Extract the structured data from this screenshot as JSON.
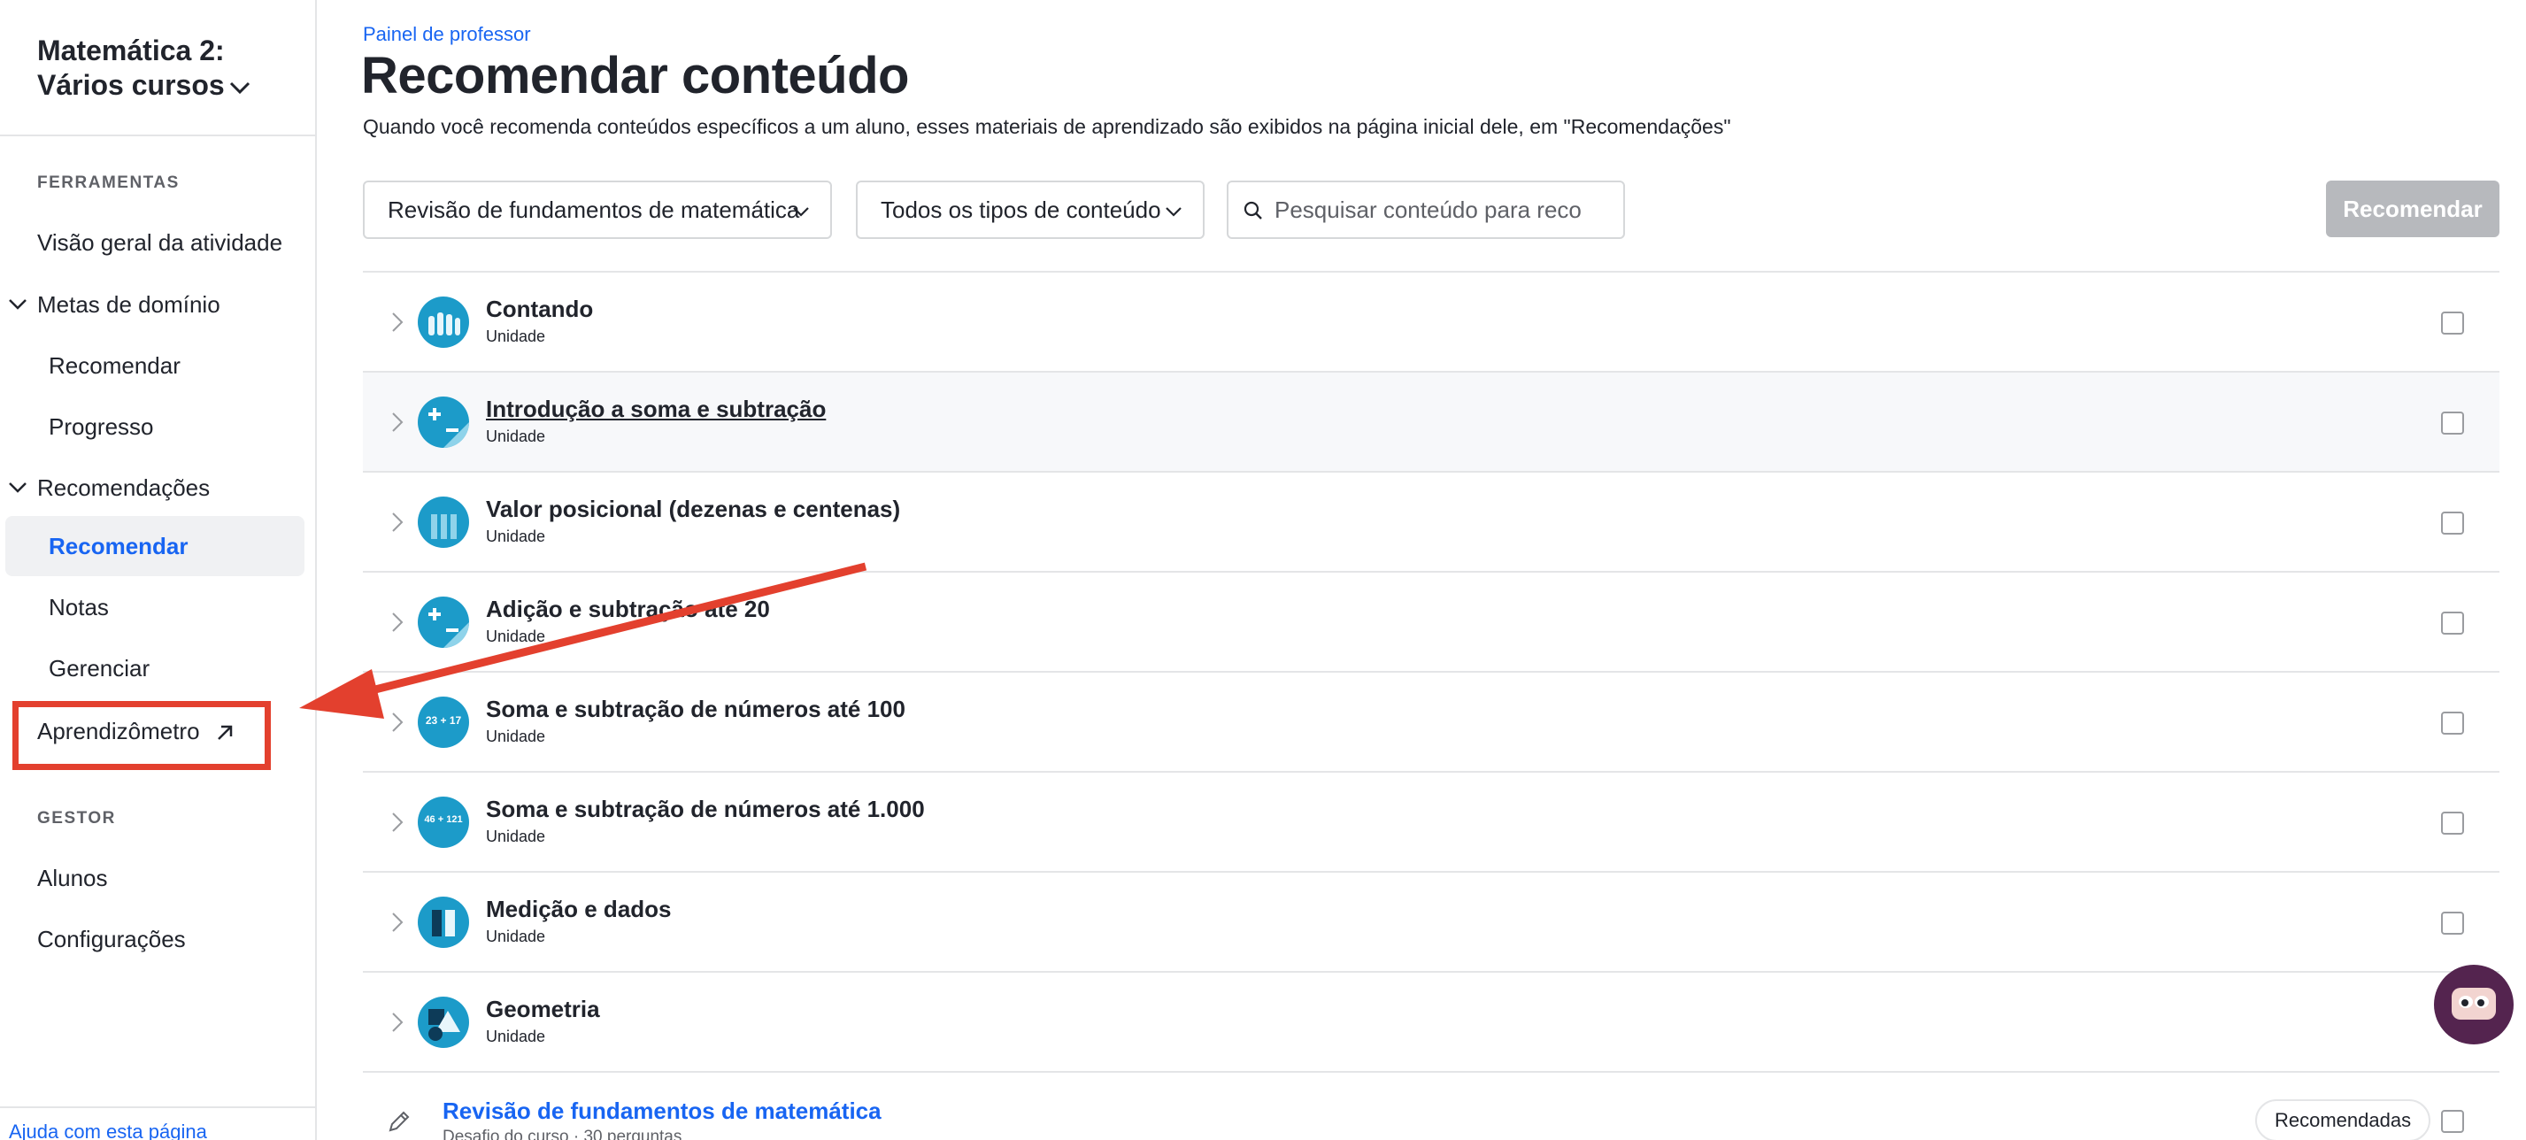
{
  "sidebar": {
    "course_title_line1": "Matemática 2:",
    "course_title_line2": "Vários cursos",
    "tools_label": "FERRAMENTAS",
    "activity_overview": "Visão geral da atividade",
    "mastery_goals": "Metas de domínio",
    "mastery_recommend": "Recomendar",
    "mastery_progress": "Progresso",
    "recommendations": "Recomendações",
    "rec_recommend": "Recomendar",
    "rec_grades": "Notas",
    "rec_manage": "Gerenciar",
    "learning_meter": "Aprendizômetro",
    "manager_label": "GESTOR",
    "students": "Alunos",
    "settings": "Configurações",
    "help": "Ajuda com esta página"
  },
  "header": {
    "breadcrumb": "Painel de professor",
    "title": "Recomendar conteúdo",
    "description": "Quando você recomenda conteúdos específicos a um aluno, esses materiais de aprendizado são exibidos na página inicial dele, em \"Recomendações\""
  },
  "filters": {
    "course_select": "Revisão de fundamentos de matemática",
    "type_select": "Todos os tipos de conteúdo",
    "search_placeholder": "Pesquisar conteúdo para reco",
    "recommend_button": "Recomendar"
  },
  "units": [
    {
      "title": "Contando",
      "subtitle": "Unidade"
    },
    {
      "title": "Introdução a soma e subtração",
      "subtitle": "Unidade"
    },
    {
      "title": "Valor posicional (dezenas e centenas)",
      "subtitle": "Unidade"
    },
    {
      "title": "Adição e subtração até 20",
      "subtitle": "Unidade"
    },
    {
      "title": "Soma e subtração de números até 100",
      "subtitle": "Unidade"
    },
    {
      "title": "Soma e subtração de números até 1.000",
      "subtitle": "Unidade"
    },
    {
      "title": "Medição e dados",
      "subtitle": "Unidade"
    },
    {
      "title": "Geometria",
      "subtitle": "Unidade"
    }
  ],
  "icon_labels": {
    "u4": "23 + 17",
    "u5": "46 + 121"
  },
  "challenge": {
    "title": "Revisão de fundamentos de matemática",
    "subtitle": "Desafio do curso · 30 perguntas",
    "badge": "Recomendadas"
  },
  "colors": {
    "accent": "#1865f2",
    "annotation": "#e3402e",
    "unit_icon": "#1c9bc9",
    "disabled_button": "#b7b9bd"
  }
}
